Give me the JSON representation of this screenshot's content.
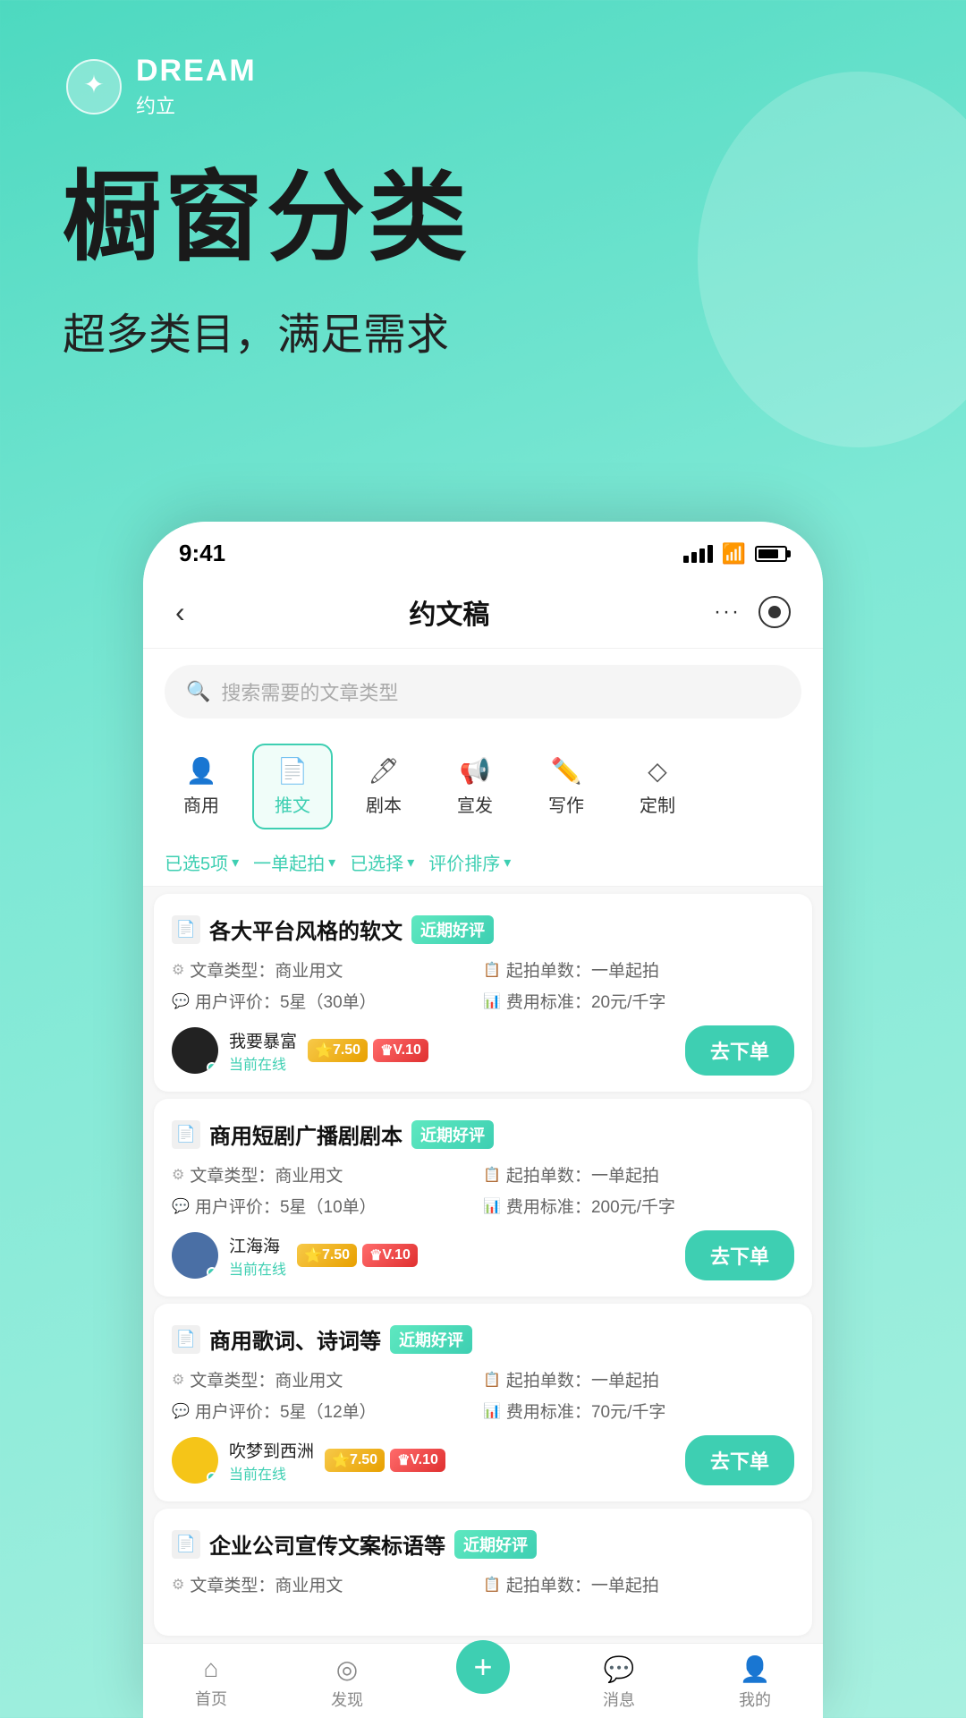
{
  "app": {
    "logo_title": "DREAM",
    "logo_subtitle": "约立",
    "status_time": "9:41",
    "headline": "橱窗分类",
    "description": "超多类目，满足需求"
  },
  "nav": {
    "back_label": "‹",
    "title": "约文稿",
    "dots": "···"
  },
  "search": {
    "placeholder": "搜索需要的文章类型"
  },
  "categories": [
    {
      "id": "shangye",
      "label": "商用",
      "icon": "👤",
      "active": false
    },
    {
      "id": "tuiwen",
      "label": "推文",
      "icon": "📄",
      "active": true
    },
    {
      "id": "juben",
      "label": "剧本",
      "icon": "🖊",
      "active": false
    },
    {
      "id": "xuanfa",
      "label": "宣发",
      "icon": "📢",
      "active": false
    },
    {
      "id": "xiezuo",
      "label": "写作",
      "icon": "✏️",
      "active": false
    },
    {
      "id": "dingzhi",
      "label": "定制",
      "icon": "◇",
      "active": false
    }
  ],
  "filters": [
    {
      "id": "selected",
      "label": "已选5项"
    },
    {
      "id": "price",
      "label": "一单起拍"
    },
    {
      "id": "chosen",
      "label": "已选择"
    },
    {
      "id": "sort",
      "label": "评价排序"
    }
  ],
  "cards": [
    {
      "title": "各大平台风格的软文",
      "badge": "近期好评",
      "article_type_label": "文章类型：",
      "article_type": "商业用文",
      "start_order_label": "起拍单数：",
      "start_order": "一单起拍",
      "user_eval_label": "用户评价：",
      "user_eval": "5星（30单）",
      "fee_label": "费用标准：",
      "fee": "20元/千字",
      "seller_name": "我要暴富",
      "online_status": "当前在线",
      "level1": "7.50",
      "level2": "V.10",
      "btn_label": "去下单"
    },
    {
      "title": "商用短剧广播剧剧本",
      "badge": "近期好评",
      "article_type_label": "文章类型：",
      "article_type": "商业用文",
      "start_order_label": "起拍单数：",
      "start_order": "一单起拍",
      "user_eval_label": "用户评价：",
      "user_eval": "5星（10单）",
      "fee_label": "费用标准：",
      "fee": "200元/千字",
      "seller_name": "江海海",
      "online_status": "当前在线",
      "level1": "7.50",
      "level2": "V.10",
      "btn_label": "去下单"
    },
    {
      "title": "商用歌词、诗词等",
      "badge": "近期好评",
      "article_type_label": "文章类型：",
      "article_type": "商业用文",
      "start_order_label": "起拍单数：",
      "start_order": "一单起拍",
      "user_eval_label": "用户评价：",
      "user_eval": "5星（12单）",
      "fee_label": "费用标准：",
      "fee": "70元/千字",
      "seller_name": "吹梦到西洲",
      "online_status": "当前在线",
      "level1": "7.50",
      "level2": "V.10",
      "btn_label": "去下单"
    },
    {
      "title": "企业公司宣传文案标语等",
      "badge": "近期好评",
      "article_type_label": "文章类型：",
      "article_type": "商业用文",
      "start_order_label": "起拍单数：",
      "start_order": "一单起拍",
      "user_eval_label": "用户评价：",
      "user_eval": "",
      "fee_label": "",
      "fee": "",
      "seller_name": "",
      "online_status": "",
      "level1": "",
      "level2": "",
      "btn_label": ""
    }
  ],
  "bottom_nav": [
    {
      "id": "home",
      "label": "首页",
      "icon": "⌂"
    },
    {
      "id": "discover",
      "label": "发现",
      "icon": "◎"
    },
    {
      "id": "add",
      "label": "",
      "icon": "+"
    },
    {
      "id": "message",
      "label": "消息",
      "icon": "💬"
    },
    {
      "id": "profile",
      "label": "我的",
      "icon": "👤"
    }
  ]
}
